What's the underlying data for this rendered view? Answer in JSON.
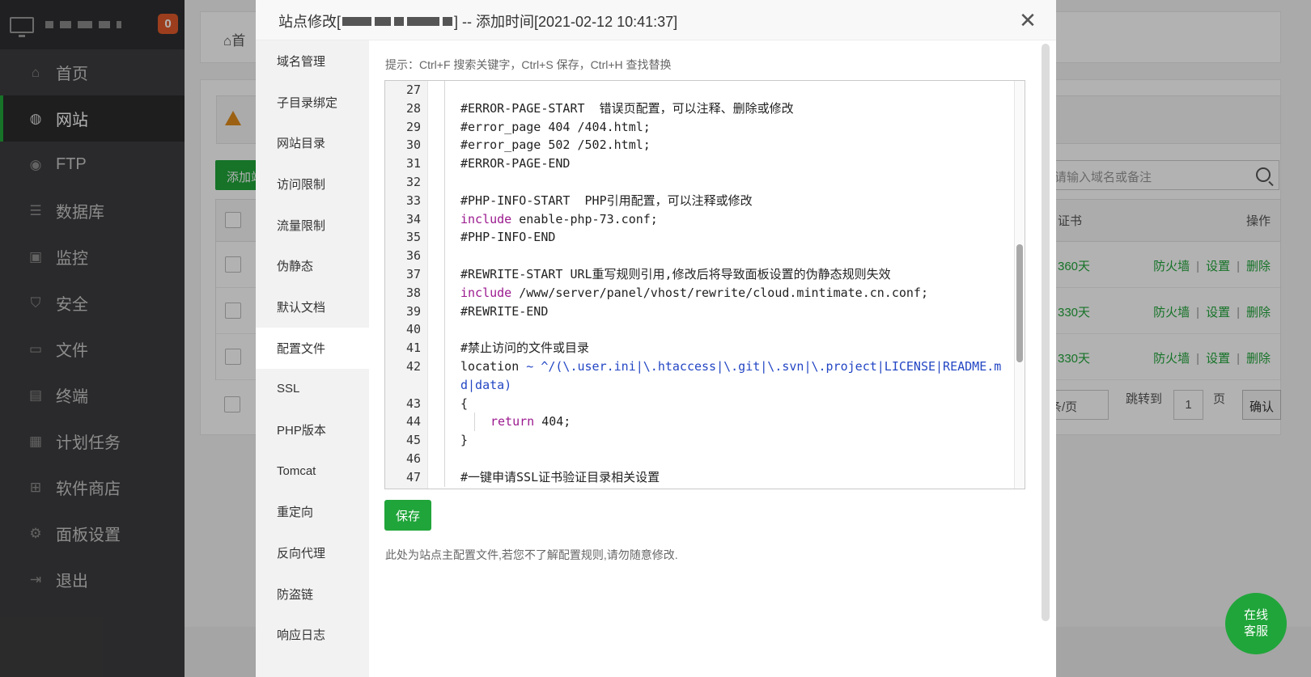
{
  "app": {
    "notification_count": "0",
    "nav": [
      {
        "label": "首页",
        "icon": "home-icon"
      },
      {
        "label": "网站",
        "icon": "globe-icon",
        "active": true
      },
      {
        "label": "FTP",
        "icon": "ftp-icon"
      },
      {
        "label": "数据库",
        "icon": "database-icon"
      },
      {
        "label": "监控",
        "icon": "monitor-icon"
      },
      {
        "label": "安全",
        "icon": "shield-icon"
      },
      {
        "label": "文件",
        "icon": "folder-icon"
      },
      {
        "label": "终端",
        "icon": "terminal-icon"
      },
      {
        "label": "计划任务",
        "icon": "calendar-icon"
      },
      {
        "label": "软件商店",
        "icon": "grid-icon"
      },
      {
        "label": "面板设置",
        "icon": "gear-icon"
      },
      {
        "label": "退出",
        "icon": "logout-icon"
      }
    ]
  },
  "background": {
    "breadcrumb": "首",
    "add_button": "添加站",
    "search_placeholder": "请输入域名或备注",
    "table_headers": {
      "cert": "证书",
      "ops": "操作"
    },
    "rows": [
      {
        "days": "360天",
        "firewall": "防火墙",
        "settings": "设置",
        "delete": "删除"
      },
      {
        "days": "330天",
        "firewall": "防火墙",
        "settings": "设置",
        "delete": "删除"
      },
      {
        "days": "330天",
        "firewall": "防火墙",
        "settings": "设置",
        "delete": "删除"
      }
    ],
    "pager": {
      "per_page": "条/页",
      "jump_label": "跳转到",
      "page_value": "1",
      "page_suffix": "页",
      "confirm": "确认"
    }
  },
  "modal": {
    "title_prefix": "站点修改[",
    "title_suffix": "] -- 添加时间[2021-02-12 10:41:37]",
    "close_label": "✕",
    "tabs": [
      "域名管理",
      "子目录绑定",
      "网站目录",
      "访问限制",
      "流量限制",
      "伪静态",
      "默认文档",
      "配置文件",
      "SSL",
      "PHP版本",
      "Tomcat",
      "重定向",
      "反向代理",
      "防盗链",
      "响应日志"
    ],
    "active_tab": "配置文件",
    "tip": "提示：Ctrl+F 搜索关键字，Ctrl+S 保存，Ctrl+H 查找替换",
    "save_label": "保存",
    "note": "此处为站点主配置文件,若您不了解配置规则,请勿随意修改.",
    "code": {
      "l27": "",
      "l28": "#ERROR-PAGE-START  错误页配置，可以注释、删除或修改",
      "l29": "#error_page 404 /404.html;",
      "l30": "#error_page 502 /502.html;",
      "l31": "#ERROR-PAGE-END",
      "l32": "",
      "l33": "#PHP-INFO-START  PHP引用配置，可以注释或修改",
      "l34_kw": "include",
      "l34_rest": " enable-php-73.conf;",
      "l35": "#PHP-INFO-END",
      "l36": "",
      "l37": "#REWRITE-START URL重写规则引用,修改后将导致面板设置的伪静态规则失效",
      "l38_kw": "include",
      "l38_rest": " /www/server/panel/vhost/rewrite/cloud.mintimate.cn.conf;",
      "l39": "#REWRITE-END",
      "l40": "",
      "l41": "#禁止访问的文件或目录",
      "l42_plain": "location ",
      "l42_rx": "~ ^/(\\.user.ini|\\.htaccess|\\.git|\\.svn|\\.project|LICENSE|README.md|data)",
      "l43": "{",
      "l44_kw": "return",
      "l44_rest": " 404;",
      "l45": "}",
      "l46": "",
      "l47": "#一键申请SSL证书验证目录相关设置"
    }
  },
  "service_button": "在线\n客服",
  "colors": {
    "accent": "#20a53a",
    "sidebar": "#3d3d3f",
    "comment": "#1f8a1f",
    "keyword": "#9b1a8f",
    "regex": "#2346c4"
  }
}
